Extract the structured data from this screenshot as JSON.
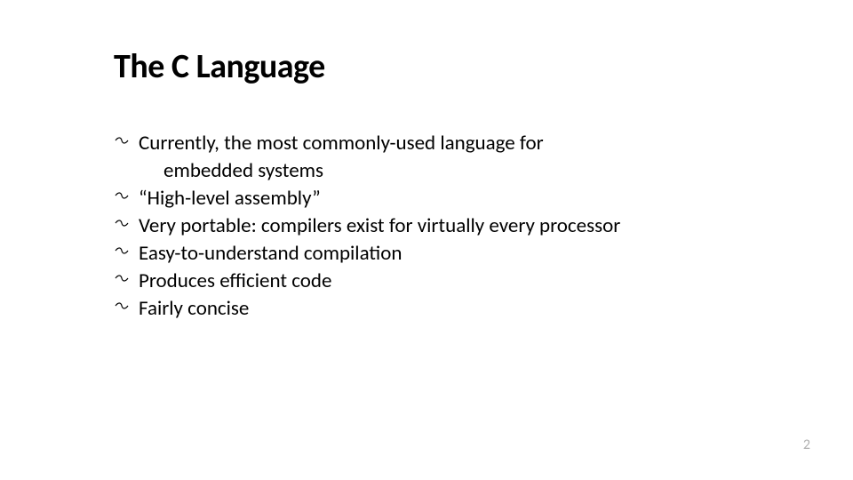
{
  "slide": {
    "title": "The C Language",
    "bullets": [
      {
        "line1": "Currently, the most commonly-used language for",
        "line2": "embedded systems"
      },
      {
        "line1": "“High-level assembly”"
      },
      {
        "line1": "Very portable: compilers exist for virtually every processor"
      },
      {
        "line1": "Easy-to-understand compilation"
      },
      {
        "line1": "Produces efficient code"
      },
      {
        "line1": "Fairly concise"
      }
    ],
    "bullet_glyph": "",
    "page_number": "2"
  }
}
